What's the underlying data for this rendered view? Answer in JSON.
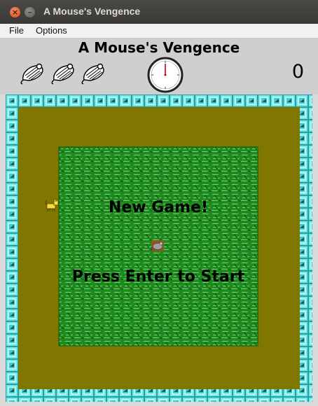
{
  "window": {
    "title": "A Mouse's Vengence",
    "close_icon": "close-icon",
    "minimize_icon": "minimize-icon"
  },
  "menu": {
    "items": [
      "File",
      "Options"
    ]
  },
  "hud": {
    "game_title": "A Mouse's Vengence",
    "lives_remaining": 3,
    "life_icon": "mouse-icon",
    "timer_icon": "stopwatch-icon",
    "score": "0"
  },
  "board": {
    "floor_color": "#7f7700",
    "wall_color": "#39c6c6",
    "grass_color": "#1e8a1e",
    "message_title": "New Game!",
    "message_prompt": "Press Enter to Start",
    "sprites": [
      "cat-icon",
      "mouse-icon"
    ]
  }
}
